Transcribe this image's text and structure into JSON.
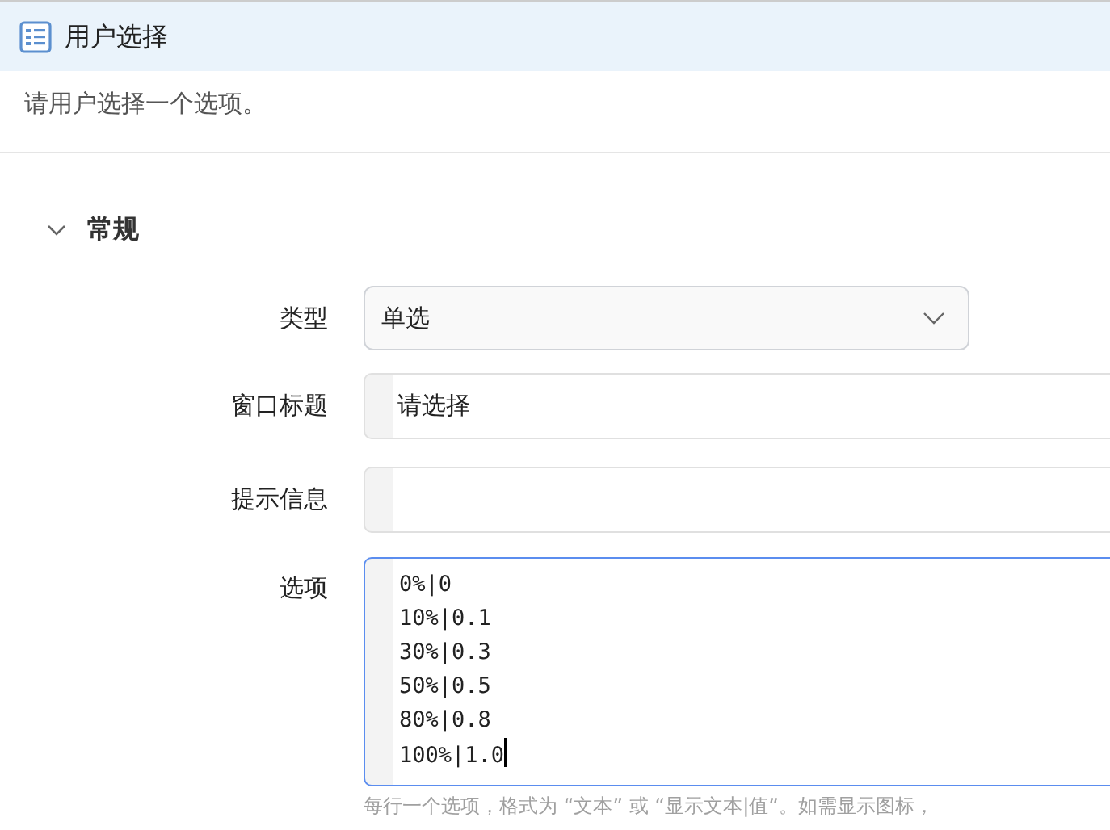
{
  "window": {
    "title": "用户选择"
  },
  "description": "请用户选择一个选项。",
  "section": {
    "title": "常规",
    "expanded": true
  },
  "fields": [
    {
      "kind": "select",
      "label": "类型",
      "value": "单选",
      "focused": false
    },
    {
      "kind": "input",
      "label": "窗口标题",
      "value": "请选择",
      "focused": false
    },
    {
      "kind": "input",
      "label": "提示信息",
      "focused": false
    },
    {
      "kind": "textarea",
      "label": "选项",
      "lines": [
        "0%|0",
        "10%|0.1",
        "30%|0.3",
        "50%|0.5",
        "80%|0.8",
        "100%|1.0"
      ],
      "focused": true
    }
  ],
  "hint": "每行一个选项，格式为 “文本” 或 “显示文本|值”。如需显示图标，"
}
